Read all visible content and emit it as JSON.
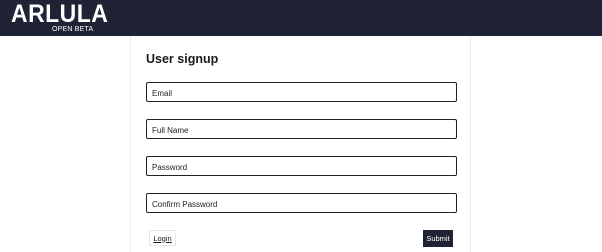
{
  "header": {
    "logo_text": "ARLULA",
    "logo_subtext": "OPEN BETA"
  },
  "form": {
    "title": "User signup",
    "email_placeholder": "Email",
    "email_value": "",
    "fullname_placeholder": "Full Name",
    "fullname_value": "",
    "password_placeholder": "Password",
    "password_value": "",
    "confirm_placeholder": "Confirm Password",
    "confirm_value": "",
    "login_label": "Login",
    "submit_label": "Submit"
  },
  "colors": {
    "header_bg": "#1f2335",
    "submit_bg": "#1f2335",
    "field_border": "#222222"
  }
}
